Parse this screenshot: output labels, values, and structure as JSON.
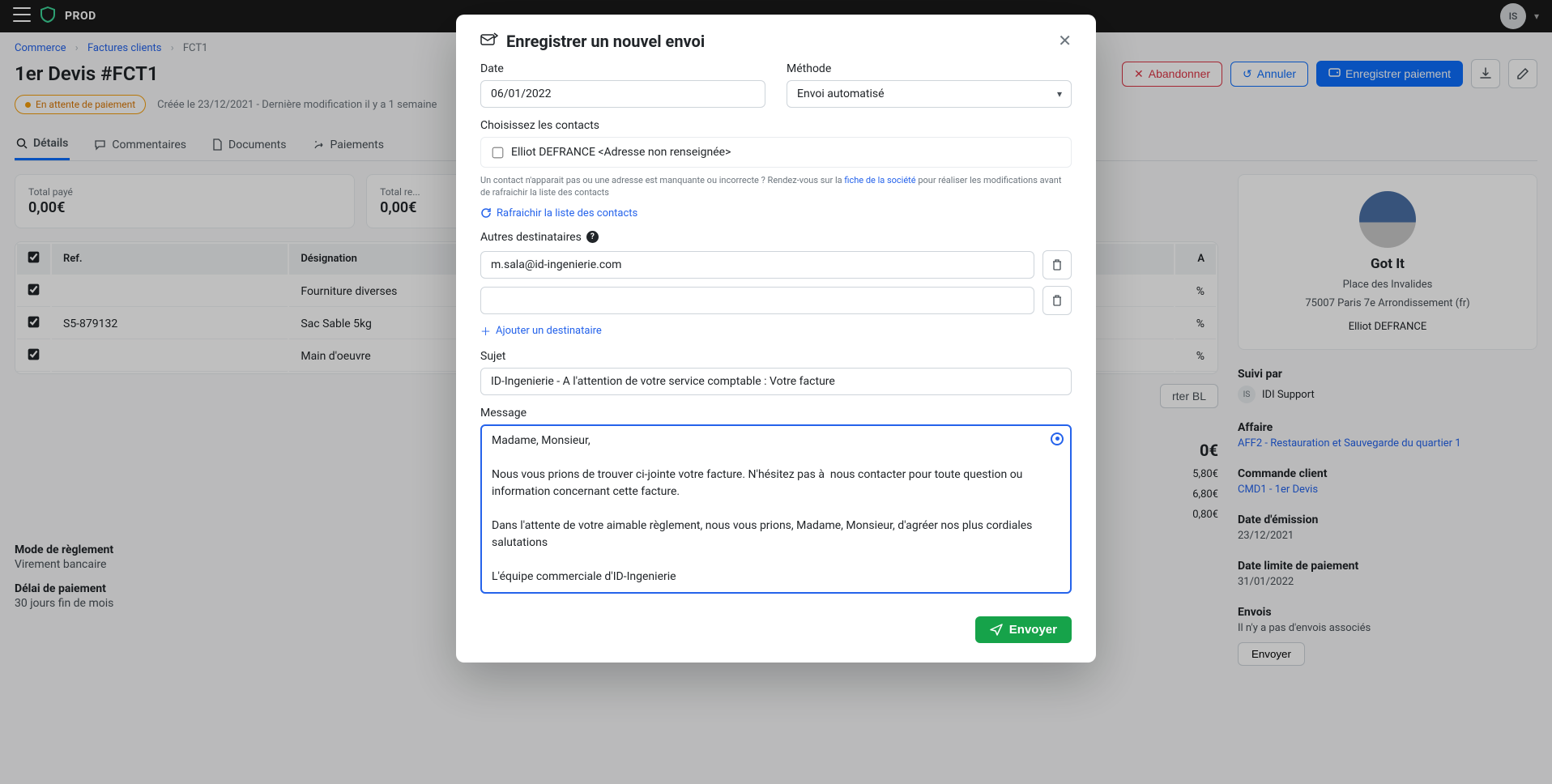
{
  "nav": {
    "brand": "PROD",
    "user_initials": "IS"
  },
  "breadcrumbs": {
    "a": "Commerce",
    "b": "Factures clients",
    "c": "FCT1"
  },
  "header": {
    "title": "1er Devis #FCT1",
    "btn_abandon": "Abandonner",
    "btn_cancel": "Annuler",
    "btn_save": "Enregistrer paiement"
  },
  "status": {
    "label": "En attente de paiement",
    "meta": "Créée le 23/12/2021 - Dernière modification il y a 1 semaine"
  },
  "tabs": {
    "details": "Détails",
    "comments": "Commentaires",
    "documents": "Documents",
    "payments": "Paiements"
  },
  "summary": {
    "paid_label": "Total payé",
    "paid_value": "0,00€",
    "rem_label": "Total re...",
    "rem_value": "0,00€"
  },
  "table": {
    "h_ref": "Ref.",
    "h_desig": "Désignation",
    "h_tva": "A",
    "rows": [
      {
        "ref": "",
        "desig": "Fourniture diverses",
        "tva": "%"
      },
      {
        "ref": "S5-879132",
        "desig": "Sac Sable 5kg",
        "tva": "%"
      },
      {
        "ref": "",
        "desig": "Main d'oeuvre",
        "tva": "%"
      }
    ]
  },
  "action_right": {
    "export_bl": "rter BL"
  },
  "totals": {
    "a": "5,80€",
    "b": "6,80€",
    "c": "0,80€",
    "big": "0€"
  },
  "reglement": {
    "mode_k": "Mode de règlement",
    "mode_v": "Virement bancaire",
    "delai_k": "Délai de paiement",
    "delai_v": "30 jours fin de mois"
  },
  "side": {
    "company": "Got It",
    "addr1": "Place des Invalides",
    "addr2": "75007 Paris 7e Arrondissement (fr)",
    "contact": "Elliot DEFRANCE",
    "suivi_label": "Suivi par",
    "suivi_initials": "IS",
    "suivi_name": "IDI Support",
    "affaire_label": "Affaire",
    "affaire_link": "AFF2 - Restauration et Sauvegarde du quartier 1",
    "commande_label": "Commande client",
    "commande_link": "CMD1 - 1er Devis",
    "emission_label": "Date d'émission",
    "emission_value": "23/12/2021",
    "limite_label": "Date limite de paiement",
    "limite_value": "31/01/2022",
    "envois_label": "Envois",
    "envois_empty": "Il n'y a pas d'envois associés",
    "btn_envoyer": "Envoyer"
  },
  "modal": {
    "title": "Enregistrer un nouvel envoi",
    "date_label": "Date",
    "date_value": "06/01/2022",
    "methode_label": "Méthode",
    "methode_value": "Envoi automatisé",
    "choose_label": "Choisissez les contacts",
    "contact1": "Elliot DEFRANCE <Adresse non renseignée>",
    "help1a": "Un contact n'apparait pas ou une adresse est manquante ou incorrecte ? Rendez-vous sur la ",
    "help1_link": "fiche de la société",
    "help1b": " pour réaliser les modifications avant de rafraichir la liste des contacts",
    "refresh": "Rafraichir la liste des contacts",
    "autres_label": "Autres destinataires",
    "dest1": "m.sala@id-ingenierie.com",
    "add_dest": "Ajouter un destinataire",
    "sujet_label": "Sujet",
    "sujet_value": "ID-Ingenierie - A l'attention de votre service comptable : Votre facture",
    "message_label": "Message",
    "message_value": "Madame, Monsieur,\n\nNous vous prions de trouver ci-jointe votre facture. N'hésitez pas à  nous contacter pour toute question ou information concernant cette facture.\n\nDans l'attente de votre aimable règlement, nous vous prions, Madame, Monsieur, d'agréer nos plus cordiales salutations\n\nL'équipe commerciale d'ID-Ingenierie",
    "btn_send": "Envoyer"
  }
}
